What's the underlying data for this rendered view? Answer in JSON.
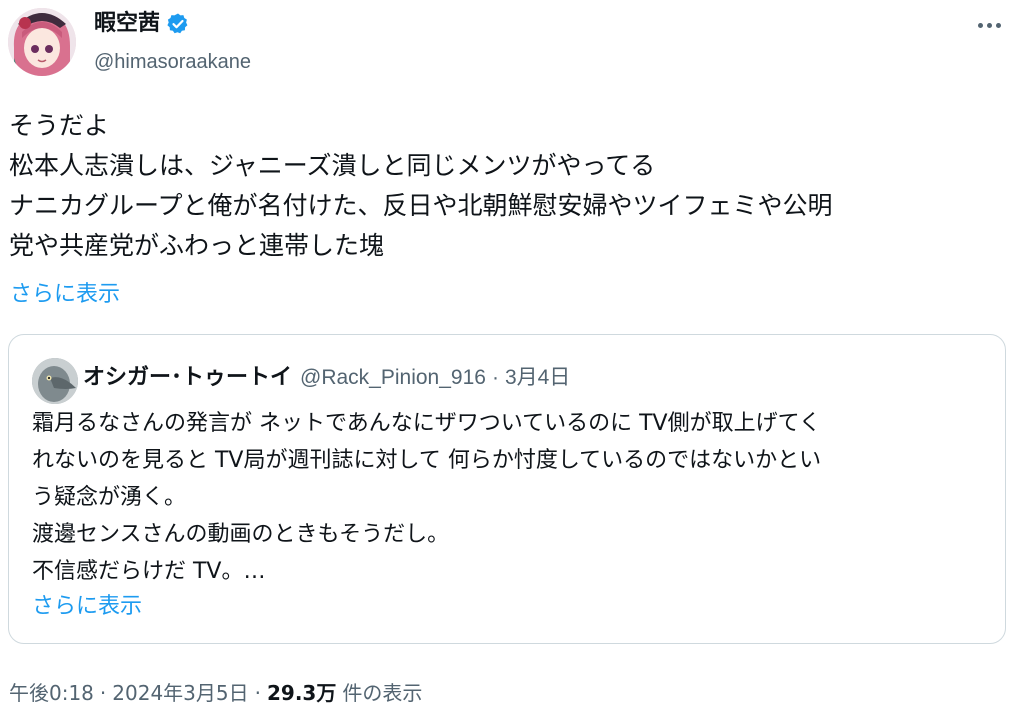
{
  "author": {
    "display_name": "暇空茜",
    "handle": "@himasoraakane",
    "verified": true
  },
  "tweet": {
    "lines": [
      "そうだよ",
      "松本人志潰しは、ジャニーズ潰しと同じメンツがやってる",
      "ナニカグループと俺が名付けた、反日や北朝鮮慰安婦やツイフェミや公明",
      "党や共産党がふわっと連帯した塊"
    ],
    "show_more": "さらに表示"
  },
  "quote": {
    "display_name": "オシガー･トゥートイ",
    "handle": "@Rack_Pinion_916",
    "separator": "·",
    "date": "3月4日",
    "lines": [
      "霜月るなさんの発言が ネットであんなにザワついているのに TV側が取上げてく",
      "れないのを見ると TV局が週刊誌に対して 何らか忖度しているのではないかとい",
      "う疑念が湧く。",
      "渡邊センスさんの動画のときもそうだし。",
      "不信感だらけだ TV。…"
    ],
    "show_more": "さらに表示"
  },
  "meta": {
    "time": "午後0:18",
    "separator": "·",
    "date": "2024年3月5日",
    "views_count": "29.3万",
    "views_label": "件の表示"
  },
  "colors": {
    "accent": "#1d9bf0",
    "text": "#0f1419",
    "secondary": "#536471",
    "border": "#cfd9de"
  },
  "icons": {
    "verified": "verified-badge-icon",
    "more": "more-options-icon"
  }
}
